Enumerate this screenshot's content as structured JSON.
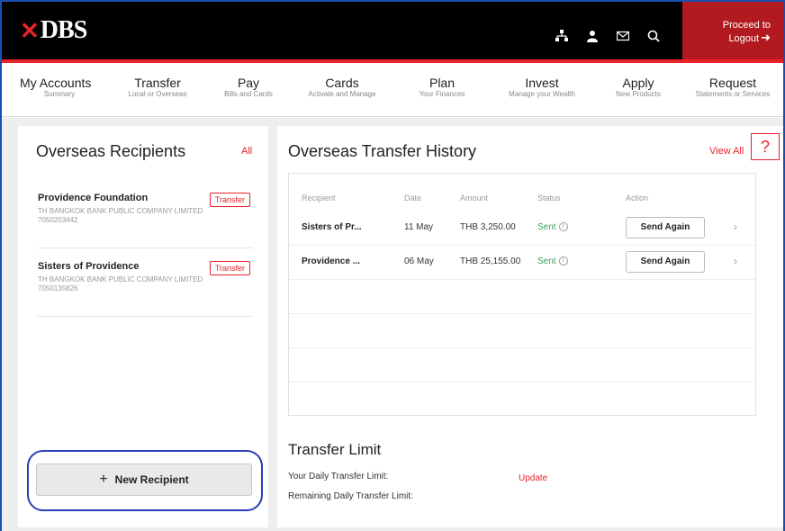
{
  "brand": {
    "logo_text": "DBS",
    "logo_mark": "✕"
  },
  "header": {
    "icons": [
      "sitemap-icon",
      "user-icon",
      "mail-icon",
      "search-icon"
    ],
    "logout_line1": "Proceed to",
    "logout_line2": "Logout"
  },
  "nav": [
    {
      "title": "My Accounts",
      "sub": "Summary"
    },
    {
      "title": "Transfer",
      "sub": "Local or Overseas"
    },
    {
      "title": "Pay",
      "sub": "Bills and Cards"
    },
    {
      "title": "Cards",
      "sub": "Activate and Manage"
    },
    {
      "title": "Plan",
      "sub": "Your Finances"
    },
    {
      "title": "Invest",
      "sub": "Manage your Wealth"
    },
    {
      "title": "Apply",
      "sub": "New Products"
    },
    {
      "title": "Request",
      "sub": "Statements or Services"
    }
  ],
  "recipients": {
    "title": "Overseas Recipients",
    "all_label": "All",
    "items": [
      {
        "name": "Providence Foundation",
        "bank": "TH BANGKOK BANK PUBLIC COMPANY LIMITED",
        "account": "7050203442",
        "action": "Transfer"
      },
      {
        "name": "Sisters of Providence",
        "bank": "TH BANGKOK BANK PUBLIC COMPANY LIMITED",
        "account": "7050135826",
        "action": "Transfer"
      }
    ],
    "new_button": "New Recipient"
  },
  "history": {
    "title": "Overseas Transfer History",
    "view_all": "View All",
    "help": "?",
    "columns": [
      "Recipient",
      "Date",
      "Amount",
      "Status",
      "Action"
    ],
    "rows": [
      {
        "recipient": "Sisters of Pr...",
        "date": "11 May",
        "amount": "THB 3,250.00",
        "status": "Sent",
        "action": "Send Again"
      },
      {
        "recipient": "Providence ...",
        "date": "06 May",
        "amount": "THB 25,155.00",
        "status": "Sent",
        "action": "Send Again"
      }
    ]
  },
  "limit": {
    "title": "Transfer Limit",
    "daily_label": "Your Daily Transfer Limit:",
    "remaining_label": "Remaining Daily Transfer Limit:",
    "update": "Update"
  },
  "colors": {
    "accent": "#e8232a",
    "header": "#000000",
    "logout": "#b21a1f",
    "sent": "#3aa15a"
  }
}
